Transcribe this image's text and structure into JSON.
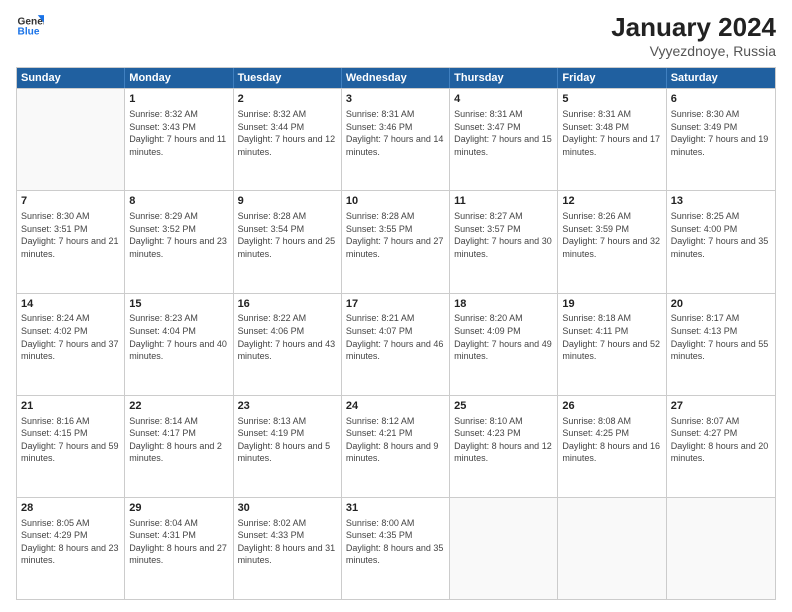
{
  "logo": {
    "line1": "General",
    "line2": "Blue"
  },
  "title": "January 2024",
  "subtitle": "Vyyezdnoye, Russia",
  "days": [
    "Sunday",
    "Monday",
    "Tuesday",
    "Wednesday",
    "Thursday",
    "Friday",
    "Saturday"
  ],
  "weeks": [
    [
      {
        "day": "",
        "sunrise": "",
        "sunset": "",
        "daylight": ""
      },
      {
        "day": "1",
        "sunrise": "Sunrise: 8:32 AM",
        "sunset": "Sunset: 3:43 PM",
        "daylight": "Daylight: 7 hours and 11 minutes."
      },
      {
        "day": "2",
        "sunrise": "Sunrise: 8:32 AM",
        "sunset": "Sunset: 3:44 PM",
        "daylight": "Daylight: 7 hours and 12 minutes."
      },
      {
        "day": "3",
        "sunrise": "Sunrise: 8:31 AM",
        "sunset": "Sunset: 3:46 PM",
        "daylight": "Daylight: 7 hours and 14 minutes."
      },
      {
        "day": "4",
        "sunrise": "Sunrise: 8:31 AM",
        "sunset": "Sunset: 3:47 PM",
        "daylight": "Daylight: 7 hours and 15 minutes."
      },
      {
        "day": "5",
        "sunrise": "Sunrise: 8:31 AM",
        "sunset": "Sunset: 3:48 PM",
        "daylight": "Daylight: 7 hours and 17 minutes."
      },
      {
        "day": "6",
        "sunrise": "Sunrise: 8:30 AM",
        "sunset": "Sunset: 3:49 PM",
        "daylight": "Daylight: 7 hours and 19 minutes."
      }
    ],
    [
      {
        "day": "7",
        "sunrise": "Sunrise: 8:30 AM",
        "sunset": "Sunset: 3:51 PM",
        "daylight": "Daylight: 7 hours and 21 minutes."
      },
      {
        "day": "8",
        "sunrise": "Sunrise: 8:29 AM",
        "sunset": "Sunset: 3:52 PM",
        "daylight": "Daylight: 7 hours and 23 minutes."
      },
      {
        "day": "9",
        "sunrise": "Sunrise: 8:28 AM",
        "sunset": "Sunset: 3:54 PM",
        "daylight": "Daylight: 7 hours and 25 minutes."
      },
      {
        "day": "10",
        "sunrise": "Sunrise: 8:28 AM",
        "sunset": "Sunset: 3:55 PM",
        "daylight": "Daylight: 7 hours and 27 minutes."
      },
      {
        "day": "11",
        "sunrise": "Sunrise: 8:27 AM",
        "sunset": "Sunset: 3:57 PM",
        "daylight": "Daylight: 7 hours and 30 minutes."
      },
      {
        "day": "12",
        "sunrise": "Sunrise: 8:26 AM",
        "sunset": "Sunset: 3:59 PM",
        "daylight": "Daylight: 7 hours and 32 minutes."
      },
      {
        "day": "13",
        "sunrise": "Sunrise: 8:25 AM",
        "sunset": "Sunset: 4:00 PM",
        "daylight": "Daylight: 7 hours and 35 minutes."
      }
    ],
    [
      {
        "day": "14",
        "sunrise": "Sunrise: 8:24 AM",
        "sunset": "Sunset: 4:02 PM",
        "daylight": "Daylight: 7 hours and 37 minutes."
      },
      {
        "day": "15",
        "sunrise": "Sunrise: 8:23 AM",
        "sunset": "Sunset: 4:04 PM",
        "daylight": "Daylight: 7 hours and 40 minutes."
      },
      {
        "day": "16",
        "sunrise": "Sunrise: 8:22 AM",
        "sunset": "Sunset: 4:06 PM",
        "daylight": "Daylight: 7 hours and 43 minutes."
      },
      {
        "day": "17",
        "sunrise": "Sunrise: 8:21 AM",
        "sunset": "Sunset: 4:07 PM",
        "daylight": "Daylight: 7 hours and 46 minutes."
      },
      {
        "day": "18",
        "sunrise": "Sunrise: 8:20 AM",
        "sunset": "Sunset: 4:09 PM",
        "daylight": "Daylight: 7 hours and 49 minutes."
      },
      {
        "day": "19",
        "sunrise": "Sunrise: 8:18 AM",
        "sunset": "Sunset: 4:11 PM",
        "daylight": "Daylight: 7 hours and 52 minutes."
      },
      {
        "day": "20",
        "sunrise": "Sunrise: 8:17 AM",
        "sunset": "Sunset: 4:13 PM",
        "daylight": "Daylight: 7 hours and 55 minutes."
      }
    ],
    [
      {
        "day": "21",
        "sunrise": "Sunrise: 8:16 AM",
        "sunset": "Sunset: 4:15 PM",
        "daylight": "Daylight: 7 hours and 59 minutes."
      },
      {
        "day": "22",
        "sunrise": "Sunrise: 8:14 AM",
        "sunset": "Sunset: 4:17 PM",
        "daylight": "Daylight: 8 hours and 2 minutes."
      },
      {
        "day": "23",
        "sunrise": "Sunrise: 8:13 AM",
        "sunset": "Sunset: 4:19 PM",
        "daylight": "Daylight: 8 hours and 5 minutes."
      },
      {
        "day": "24",
        "sunrise": "Sunrise: 8:12 AM",
        "sunset": "Sunset: 4:21 PM",
        "daylight": "Daylight: 8 hours and 9 minutes."
      },
      {
        "day": "25",
        "sunrise": "Sunrise: 8:10 AM",
        "sunset": "Sunset: 4:23 PM",
        "daylight": "Daylight: 8 hours and 12 minutes."
      },
      {
        "day": "26",
        "sunrise": "Sunrise: 8:08 AM",
        "sunset": "Sunset: 4:25 PM",
        "daylight": "Daylight: 8 hours and 16 minutes."
      },
      {
        "day": "27",
        "sunrise": "Sunrise: 8:07 AM",
        "sunset": "Sunset: 4:27 PM",
        "daylight": "Daylight: 8 hours and 20 minutes."
      }
    ],
    [
      {
        "day": "28",
        "sunrise": "Sunrise: 8:05 AM",
        "sunset": "Sunset: 4:29 PM",
        "daylight": "Daylight: 8 hours and 23 minutes."
      },
      {
        "day": "29",
        "sunrise": "Sunrise: 8:04 AM",
        "sunset": "Sunset: 4:31 PM",
        "daylight": "Daylight: 8 hours and 27 minutes."
      },
      {
        "day": "30",
        "sunrise": "Sunrise: 8:02 AM",
        "sunset": "Sunset: 4:33 PM",
        "daylight": "Daylight: 8 hours and 31 minutes."
      },
      {
        "day": "31",
        "sunrise": "Sunrise: 8:00 AM",
        "sunset": "Sunset: 4:35 PM",
        "daylight": "Daylight: 8 hours and 35 minutes."
      },
      {
        "day": "",
        "sunrise": "",
        "sunset": "",
        "daylight": ""
      },
      {
        "day": "",
        "sunrise": "",
        "sunset": "",
        "daylight": ""
      },
      {
        "day": "",
        "sunrise": "",
        "sunset": "",
        "daylight": ""
      }
    ]
  ]
}
